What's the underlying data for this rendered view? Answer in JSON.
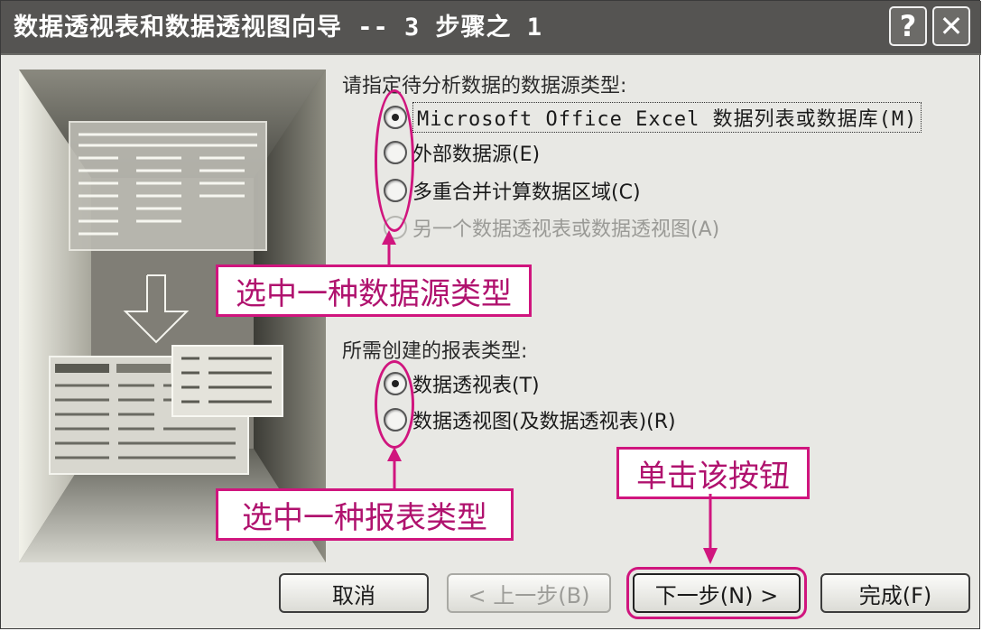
{
  "window": {
    "title": "数据透视表和数据透视图向导 -- 3 步骤之 1",
    "help_label": "?",
    "close_label": "✕"
  },
  "source_section": {
    "label": "请指定待分析数据的数据源类型:",
    "options": [
      {
        "label": "Microsoft Office Excel 数据列表或数据库(M)",
        "checked": true,
        "enabled": true
      },
      {
        "label": "外部数据源(E)",
        "checked": false,
        "enabled": true
      },
      {
        "label": "多重合并计算数据区域(C)",
        "checked": false,
        "enabled": true
      },
      {
        "label": "另一个数据透视表或数据透视图(A)",
        "checked": false,
        "enabled": false
      }
    ]
  },
  "report_section": {
    "label": "所需创建的报表类型:",
    "options": [
      {
        "label": "数据透视表(T)",
        "checked": true,
        "enabled": true
      },
      {
        "label": "数据透视图(及数据透视表)(R)",
        "checked": false,
        "enabled": true
      }
    ]
  },
  "annotations": {
    "source_callout": "选中一种数据源类型",
    "report_callout": "选中一种报表类型",
    "button_callout": "单击该按钮",
    "accent_color": "#d0157e"
  },
  "buttons": {
    "cancel": "取消",
    "back": "< 上一步(B)",
    "next": "下一步(N) >",
    "finish": "完成(F)"
  },
  "icons": {
    "illustration_arrow": "down-arrow-icon"
  }
}
